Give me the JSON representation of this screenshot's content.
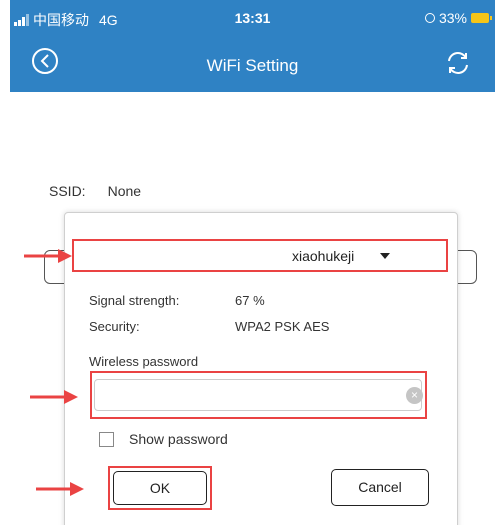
{
  "status_bar": {
    "carrier": "中国移动",
    "network": "4G",
    "time": "13:31",
    "battery": "33%"
  },
  "nav": {
    "title": "WiFi Setting",
    "back_icon": "chevron-left-icon",
    "refresh_icon": "refresh-icon"
  },
  "ssid": {
    "label": "SSID:",
    "value": "None"
  },
  "dialog": {
    "network_name": "xiaohukeji",
    "signal_label": "Signal strength:",
    "signal_value": "67 %",
    "security_label": "Security:",
    "security_value": "WPA2 PSK AES",
    "password_label": "Wireless password",
    "password_value": "",
    "show_password_label": "Show password",
    "show_password_checked": false,
    "ok_label": "OK",
    "cancel_label": "Cancel"
  },
  "colors": {
    "header": "#2f82c4",
    "highlight": "#ea4343",
    "battery": "#f5c518"
  }
}
